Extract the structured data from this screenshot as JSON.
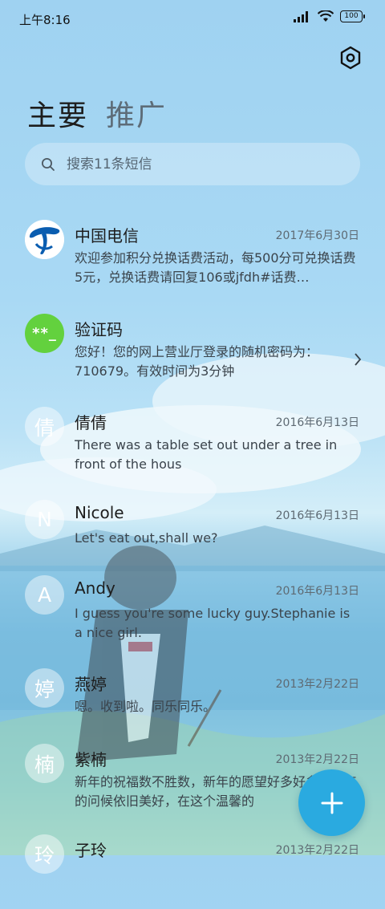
{
  "status_bar": {
    "time": "上午8:16",
    "battery": "100"
  },
  "tabs": [
    {
      "label": "主要"
    },
    {
      "label": "推广"
    }
  ],
  "search": {
    "placeholder": "搜索11条短信"
  },
  "conversations": [
    {
      "avatar": "telecom-logo",
      "name": "中国电信",
      "date": "2017年6月30日",
      "preview": "欢迎参加积分兑换话费活动，每500分可兑换话费5元，兑换话费请回复106或jfdh#话费…"
    },
    {
      "avatar": "**_",
      "name": "验证码",
      "date": "",
      "preview": "您好！您的网上营业厅登录的随机密码为：710679。有效时间为3分钟"
    },
    {
      "avatar": "倩",
      "name": "倩倩",
      "date": "2016年6月13日",
      "preview": "There was a table set out under a tree in front of the hous"
    },
    {
      "avatar": "N",
      "name": "Nicole",
      "date": "2016年6月13日",
      "preview": "Let's eat out,shall we?"
    },
    {
      "avatar": "A",
      "name": "Andy",
      "date": "2016年6月13日",
      "preview": "I guess you're some lucky guy.Stephanie is a nice girl."
    },
    {
      "avatar": "婷",
      "name": "燕婷",
      "date": "2013年2月22日",
      "preview": "嗯。收到啦。同乐同乐。"
    },
    {
      "avatar": "楠",
      "name": "紫楠",
      "date": "2013年2月22日",
      "preview": "新年的祝福数不胜数，新年的愿望好多好多，新年的问候依旧美好，在这个温馨的"
    },
    {
      "avatar": "玲",
      "name": "子玲",
      "date": "2013年2月22日",
      "preview": ""
    }
  ],
  "colors": {
    "accent": "#2aaae0",
    "verify_avatar": "#63d13e",
    "telecom_blue": "#0a5db0"
  },
  "icons": {
    "settings": "settings-hexagon-icon",
    "search": "search-icon",
    "chevron": "chevron-right-icon",
    "compose": "plus-icon"
  }
}
